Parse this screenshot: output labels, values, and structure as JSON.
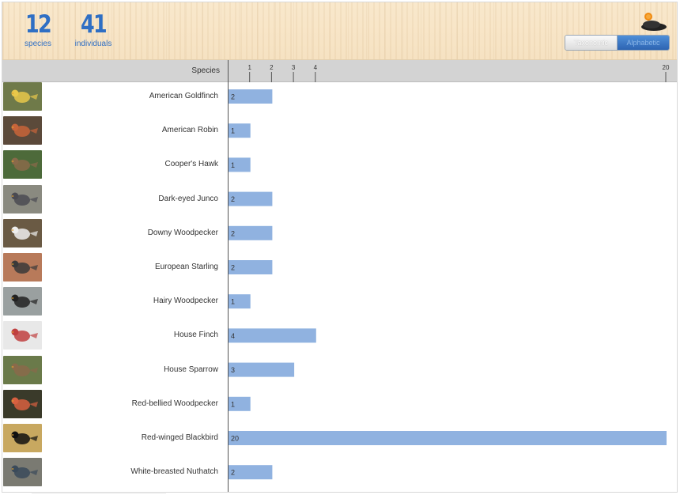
{
  "stats": {
    "species_count": "12",
    "species_label": "species",
    "individuals_count": "41",
    "individuals_label": "individuals"
  },
  "toggle": {
    "taxonomic_label": "Taxonomic",
    "alphabetic_label": "Alphabetic",
    "selected": "Alphabetic"
  },
  "colors": {
    "accent": "#2f6fc4",
    "bar": "#90b2e0",
    "header_bar": "#d3d3d3"
  },
  "chart_data": {
    "type": "bar",
    "orientation": "horizontal",
    "category_header": "Species",
    "tick_values": [
      1,
      2,
      3,
      4,
      20
    ],
    "xlim": [
      0,
      20
    ],
    "categories": [
      "American Goldfinch",
      "American Robin",
      "Cooper's Hawk",
      "Dark-eyed Junco",
      "Downy Woodpecker",
      "European Starling",
      "Hairy Woodpecker",
      "House Finch",
      "House Sparrow",
      "Red-bellied Woodpecker",
      "Red-winged Blackbird",
      "White-breasted Nuthatch"
    ],
    "values": [
      2,
      1,
      1,
      2,
      2,
      2,
      1,
      4,
      3,
      1,
      20,
      2
    ],
    "thumbnails": [
      "american-goldfinch-photo",
      "american-robin-photo",
      "coopers-hawk-photo",
      "dark-eyed-junco-photo",
      "downy-woodpecker-photo",
      "european-starling-photo",
      "hairy-woodpecker-photo",
      "house-finch-photo",
      "house-sparrow-photo",
      "red-bellied-woodpecker-photo",
      "red-winged-blackbird-photo",
      "white-breasted-nuthatch-photo"
    ],
    "thumb_colors": [
      [
        "#6f7a4a",
        "#e8c84a"
      ],
      [
        "#5b4a3a",
        "#c8643a"
      ],
      [
        "#4d6a3a",
        "#8a6a4a"
      ],
      [
        "#8a8a80",
        "#4a4a52"
      ],
      [
        "#6a5a44",
        "#eeeeee"
      ],
      [
        "#b87a5a",
        "#3a3a3a"
      ],
      [
        "#9aa0a0",
        "#222222"
      ],
      [
        "#e8e8e8",
        "#c04040"
      ],
      [
        "#6a7a4a",
        "#8a6a4a"
      ],
      [
        "#3a3a2a",
        "#d86040"
      ],
      [
        "#c8a860",
        "#111111"
      ],
      [
        "#7a7a72",
        "#3a4a5a"
      ]
    ]
  }
}
